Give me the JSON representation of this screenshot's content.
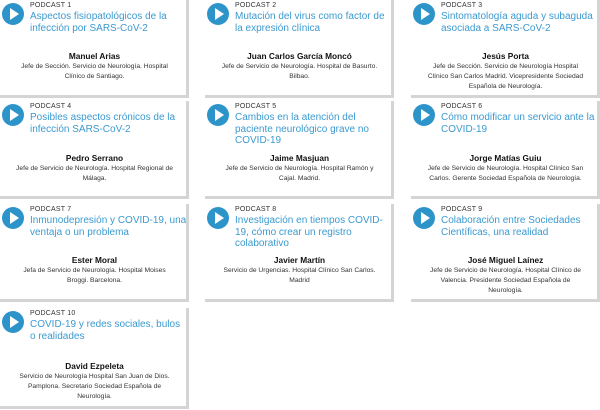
{
  "podcasts": [
    {
      "number": "PODCAST 1",
      "title": "Aspectos fisiopatológicos de la infección por SARS-CoV-2",
      "author": "Manuel Arias",
      "role": "Jefe de Sección. Servicio de Neurología. Hospital Clínico de Santiago."
    },
    {
      "number": "PODCAST 2",
      "title": "Mutación del virus como factor de la expresión clínica",
      "author": "Juan Carlos García Moncó",
      "role": "Jefe de Servicio de Neurología. Hospital de Basurto. Bilbao."
    },
    {
      "number": "PODCAST 3",
      "title": "Sintomatología aguda y subaguda asociada a SARS-CoV-2",
      "author": "Jesús Porta",
      "role": "Jefe de Sección. Servicio de Neurología Hospital Clínico San Carlos Madrid. Vicepresidente Sociedad Española de Neurología."
    },
    {
      "number": "PODCAST 4",
      "title": "Posibles aspectos crónicos de la infección SARS-CoV-2",
      "author": "Pedro Serrano",
      "role": "Jefe de Servicio de Neurología. Hospital Regional de Málaga."
    },
    {
      "number": "PODCAST 5",
      "title": "Cambios en la atención del paciente neurológico grave no COVID-19",
      "author": "Jaime Masjuan",
      "role": "Jefe de Servicio de Neurología. Hospital Ramón y Cajal. Madrid."
    },
    {
      "number": "PODCAST 6",
      "title": "Cómo modificar un servicio ante la COVID-19",
      "author": "Jorge Matías Guiu",
      "role": "Jefe de Servicio de Neurología. Hospital Clínico San Carlos. Gerente Sociedad Española de Neurología."
    },
    {
      "number": "PODCAST 7",
      "title": "Inmunodepresión y COVID-19, una ventaja o un problema",
      "author": "Ester Moral",
      "role": "Jefa de Servicio de Neurología. Hospital Moises Broggi. Barcelona."
    },
    {
      "number": "PODCAST 8",
      "title": "Investigación en tiempos COVID-19, cómo crear un registro colaborativo",
      "author": "Javier Martín",
      "role": "Servicio de Urgencias. Hospital Clínico San Carlos. Madrid"
    },
    {
      "number": "PODCAST 9",
      "title": "Colaboración entre Sociedades Científicas, una realidad",
      "author": "José Miguel Laínez",
      "role": "Jefe de Servicio de Neurología. Hospital Clínico de Valencia. Presidente Sociedad Española de Neurología."
    },
    {
      "number": "PODCAST 10",
      "title": "COVID-19 y redes sociales, bulos o realidades",
      "author": "David Ezpeleta",
      "role": "Servicio de Neurología Hospital San Juan de Dios. Pamplona. Secretario Sociedad Española de Neurología."
    }
  ]
}
